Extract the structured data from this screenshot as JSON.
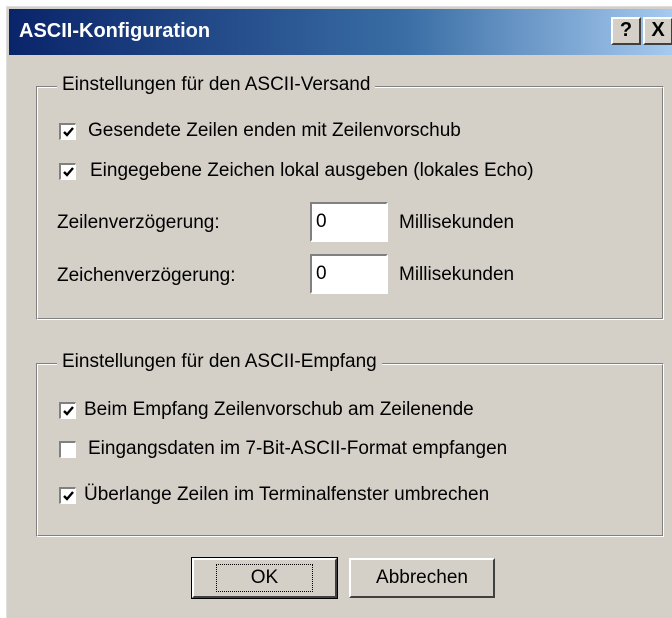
{
  "window": {
    "title": "ASCII-Konfiguration",
    "help_icon": "question-mark",
    "help_label": "?",
    "close_icon": "close-x",
    "close_label": "X"
  },
  "send_group": {
    "title": "Einstellungen für den ASCII-Versand",
    "checkboxes": [
      {
        "label": "Gesendete Zeilen enden mit Zeilenvorschub",
        "checked": true
      },
      {
        "label": "Eingegebene Zeichen lokal ausgeben (lokales Echo)",
        "checked": true
      }
    ],
    "line_delay": {
      "label": "Zeilenverzögerung:",
      "value": "0",
      "unit": "Millisekunden"
    },
    "char_delay": {
      "label": "Zeichenverzögerung:",
      "value": "0",
      "unit": "Millisekunden"
    }
  },
  "receive_group": {
    "title": "Einstellungen für den ASCII-Empfang",
    "checkboxes": [
      {
        "label": "Beim Empfang Zeilenvorschub am Zeilenende",
        "checked": true
      },
      {
        "label": "Eingangsdaten im 7-Bit-ASCII-Format empfangen",
        "checked": false
      },
      {
        "label": "Überlange Zeilen im Terminalfenster umbrechen",
        "checked": true
      }
    ]
  },
  "buttons": {
    "ok_label": "OK",
    "cancel_label": "Abbrechen"
  },
  "colors": {
    "dialog_bg": "#d4d0c8",
    "titlebar_start": "#0a246a",
    "titlebar_end": "#a6caf0",
    "title_text": "#ffffff"
  }
}
